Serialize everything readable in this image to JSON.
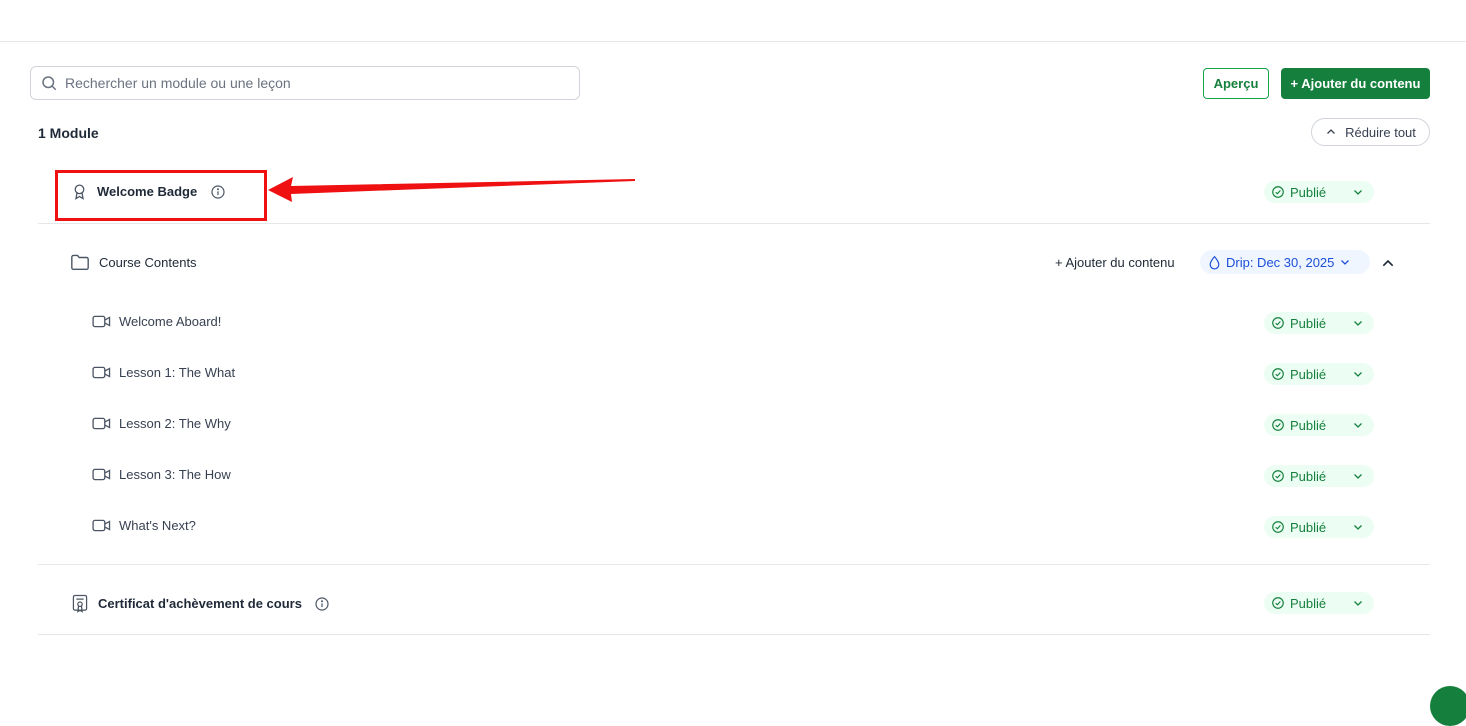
{
  "search": {
    "placeholder": "Rechercher un module ou une leçon"
  },
  "toolbar": {
    "preview_label": "Aperçu",
    "add_content_label": "+ Ajouter du contenu"
  },
  "summary": {
    "module_count": "1 Module",
    "collapse_all_label": "Réduire tout"
  },
  "badge_item": {
    "title": "Welcome Badge",
    "status": "Publié"
  },
  "module": {
    "title": "Course Contents",
    "add_content_label": "+ Ajouter du contenu",
    "drip_label": "Drip: Dec 30, 2025",
    "lessons": [
      {
        "title": "Welcome Aboard!",
        "status": "Publié"
      },
      {
        "title": "Lesson 1: The What",
        "status": "Publié"
      },
      {
        "title": "Lesson 2: The Why",
        "status": "Publié"
      },
      {
        "title": "Lesson 3: The How",
        "status": "Publié"
      },
      {
        "title": "What's Next?",
        "status": "Publié"
      }
    ]
  },
  "certificate_item": {
    "title": "Certificat d'achèvement de cours",
    "status": "Publié"
  },
  "colors": {
    "primary": "#15803d",
    "status_bg": "#ecfdf3",
    "drip_text": "#1d4ed8",
    "annotation": "#ef1111"
  }
}
